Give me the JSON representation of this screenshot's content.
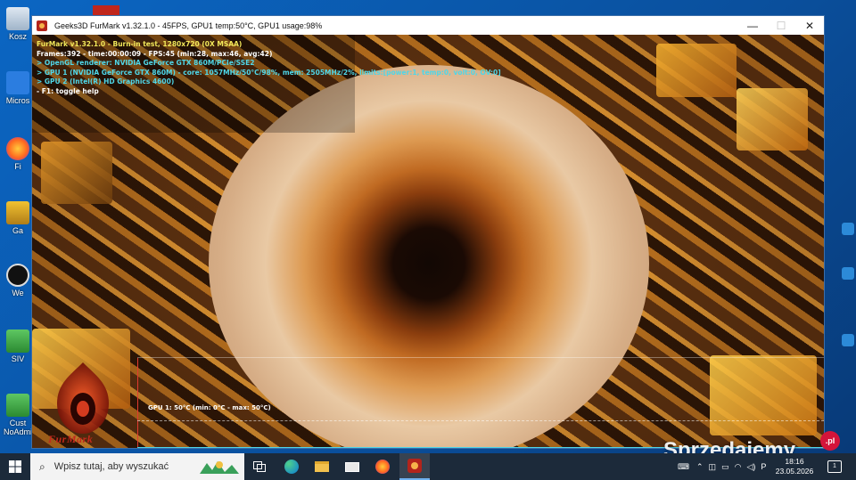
{
  "desktop": {
    "icons": [
      {
        "label": "Kosz"
      },
      {
        "label": "Micros"
      },
      {
        "label": "Fi"
      },
      {
        "label": "Ga"
      },
      {
        "label": "We"
      },
      {
        "label": "SIV"
      },
      {
        "label": "Cust"
      },
      {
        "label": "NoAdmi"
      }
    ]
  },
  "window": {
    "title": "Geeks3D FurMark v1.32.1.0 - 45FPS, GPU1 temp:50°C, GPU1 usage:98%",
    "minimize": "—",
    "maximize": "☐",
    "close": "✕"
  },
  "hud": {
    "line1": "FurMark v1.32.1.0 - Burn-in test, 1280x720 (0X MSAA)",
    "line2": "Frames:392 - time:00:00:09 - FPS:45 (min:28, max:46, avg:42)",
    "line3": "> OpenGL renderer: NVIDIA GeForce GTX 860M/PCIe/SSE2",
    "line4": "> GPU 1 (NVIDIA GeForce GTX 860M) - core: 1057MHz/50°C/98%, mem: 2505MHz/2%, limits:[power:1, temp:0, volt:0, OV:0]",
    "line5": "> GPU 2 (Intel(R) HD Graphics 4600)",
    "line6": "- F1: toggle help"
  },
  "graph": {
    "label": "GPU 1: 50°C (min: 0°C - max: 50°C)",
    "temperature_current_c": 50,
    "temperature_min_c": 0,
    "temperature_max_c": 50
  },
  "logo": {
    "text": "FurMark"
  },
  "watermark": {
    "text": "Sprzedajemy",
    "suffix": ".pl"
  },
  "taskbar": {
    "search_placeholder": "Wpisz tutaj, aby wyszukać",
    "time": "18:16",
    "date": "23.05.2026",
    "notification_count": "1",
    "icons": [
      "task-view-icon",
      "edge-icon",
      "file-explorer-icon",
      "mail-icon",
      "firefox-icon",
      "furmark-icon"
    ]
  },
  "colors": {
    "hud_yellow": "#f2e85a",
    "hud_cyan": "#4fd6e8",
    "graph_axis": "#e03a30",
    "taskbar": "#1c2a3a"
  }
}
